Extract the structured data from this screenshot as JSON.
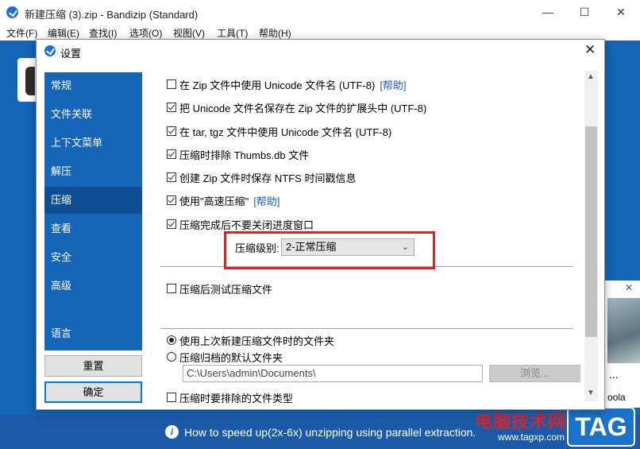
{
  "window": {
    "title": "新建压缩 (3).zip - Bandizip (Standard)",
    "minimize": "—",
    "maximize": "☐",
    "close": "✕"
  },
  "menu": [
    "文件(F)",
    "编辑(E)",
    "查找(I)",
    "选项(O)",
    "视图(V)",
    "工具(T)",
    "帮助(H)"
  ],
  "dialog": {
    "title": "设置",
    "close": "✕",
    "nav": [
      "常规",
      "文件关联",
      "上下文菜单",
      "解压",
      "压缩",
      "查看",
      "安全",
      "高级",
      "语言"
    ],
    "active_nav": "压缩",
    "reset_button": "重置",
    "ok_button": "确定",
    "options": {
      "o1": {
        "label": "在 Zip 文件中使用 Unicode 文件名 (UTF-8)",
        "help": "[帮助]",
        "checked": false
      },
      "o2": {
        "label": "把 Unicode 文件名保存在 Zip 文件的扩展头中 (UTF-8)",
        "checked": true
      },
      "o3": {
        "label": "在 tar, tgz 文件中使用 Unicode 文件名 (UTF-8)",
        "checked": true
      },
      "o4": {
        "label": "压缩时排除 Thumbs.db 文件",
        "checked": true
      },
      "o5": {
        "label": "创建 Zip 文件时保存 NTFS 时间戳信息",
        "checked": true
      },
      "o6": {
        "label": "使用\"高速压缩\"",
        "help": "[帮助]",
        "checked": true
      },
      "o7": {
        "label": "压缩完成后不要关闭进度窗口",
        "checked": true
      },
      "o8": {
        "label": "压缩后测试压缩文件",
        "checked": false
      },
      "r1": {
        "label": "使用上次新建压缩文件时的文件夹",
        "checked": true
      },
      "r2": {
        "label": "压缩归档的默认文件夹",
        "checked": false
      },
      "o9": {
        "label": "压缩时要排除的文件类型",
        "checked": false
      }
    },
    "compression_level": {
      "label": "压缩级别:",
      "value": "2-正常压缩"
    },
    "default_folder_path": "C:\\Users\\admin\\Documents\\",
    "browse_button": "浏览..."
  },
  "side_thumb": {
    "dots": "...",
    "word": "oola",
    "close": "✕"
  },
  "bottom_tip": {
    "icon": "i",
    "text": "How to speed up(2x-6x) unzipping using parallel extraction."
  },
  "watermark": {
    "site_name": "电脑技术网",
    "url": "www.tagxp.com",
    "badge": "TAG"
  }
}
